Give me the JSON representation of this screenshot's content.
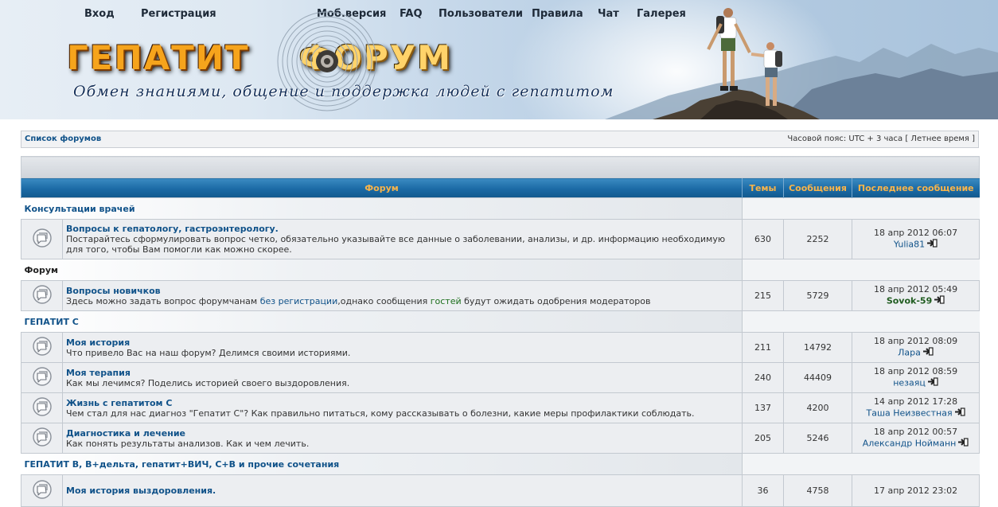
{
  "nav": [
    "Вход",
    "Регистрация",
    "Моб.версия",
    "FAQ",
    "Пользователи",
    "Правила",
    "Чат",
    "Галерея"
  ],
  "logo": {
    "word1": "ГЕПАТИТ",
    "word2": "ФОРУМ"
  },
  "slogan": "Обмен знаниями, общение и поддержка людей с гепатитом",
  "breadcrumb": "Список форумов",
  "timezone": "Часовой пояс: UTC + 3 часа [ Летнее время ]",
  "table_headers": {
    "forum": "Форум",
    "topics": "Темы",
    "posts": "Сообщения",
    "last": "Последнее сообщение"
  },
  "categories": [
    {
      "title": "Консультации врачей",
      "style": "blue",
      "forums": [
        {
          "title": "Вопросы к гепатологу, гастроэнтерологу.",
          "desc": "Постарайтесь сформулировать вопрос четко, обязательно указывайте все данные о заболевании, анализы, и др. информацию необходимую для того, чтобы Вам помогли как можно скорее.",
          "topics": "630",
          "posts": "2252",
          "date": "18 апр 2012 06:07",
          "author": "Yulia81"
        }
      ]
    },
    {
      "title": "Форум",
      "style": "dark",
      "forums": [
        {
          "title": "Вопросы новичков",
          "desc_parts": [
            "Здесь можно задать вопрос форумчанам ",
            "без регистрации",
            ",однако сообщения ",
            "гостей",
            " будут ожидать одобрения модераторов"
          ],
          "topics": "215",
          "posts": "5729",
          "date": "18 апр 2012 05:49",
          "author": "Sovok-59"
        }
      ]
    },
    {
      "title": "ГЕПАТИТ С",
      "style": "blue",
      "forums": [
        {
          "title": "Моя история",
          "desc": "Что привело Вас на наш форум? Делимся своими историями.",
          "topics": "211",
          "posts": "14792",
          "date": "18 апр 2012 08:09",
          "author": "Лара"
        },
        {
          "title": "Моя терапия",
          "desc": "Как мы лечимся? Поделись историей своего выздоровления.",
          "topics": "240",
          "posts": "44409",
          "date": "18 апр 2012 08:59",
          "author": "незаяц"
        },
        {
          "title": "Жизнь с гепатитом С",
          "desc": "Чем стал для нас диагноз \"Гепатит С\"? Как правильно питаться, кому рассказывать о болезни, какие меры профилактики соблюдать.",
          "topics": "137",
          "posts": "4200",
          "date": "14 апр 2012 17:28",
          "author": "Таша Неизвестная"
        },
        {
          "title": "Диагностика и лечение",
          "desc": "Как понять результаты анализов. Как и чем лечить.",
          "topics": "205",
          "posts": "5246",
          "date": "18 апр 2012 00:57",
          "author": "Александр Нойманн"
        }
      ]
    },
    {
      "title": "ГЕПАТИТ В, В+дельта, гепатит+ВИЧ, С+В и прочие сочетания",
      "style": "blue",
      "forums": [
        {
          "title": "Моя история выздоровления.",
          "desc": "",
          "topics": "36",
          "posts": "4758",
          "date": "17 апр 2012 23:02",
          "author": ""
        }
      ]
    }
  ]
}
